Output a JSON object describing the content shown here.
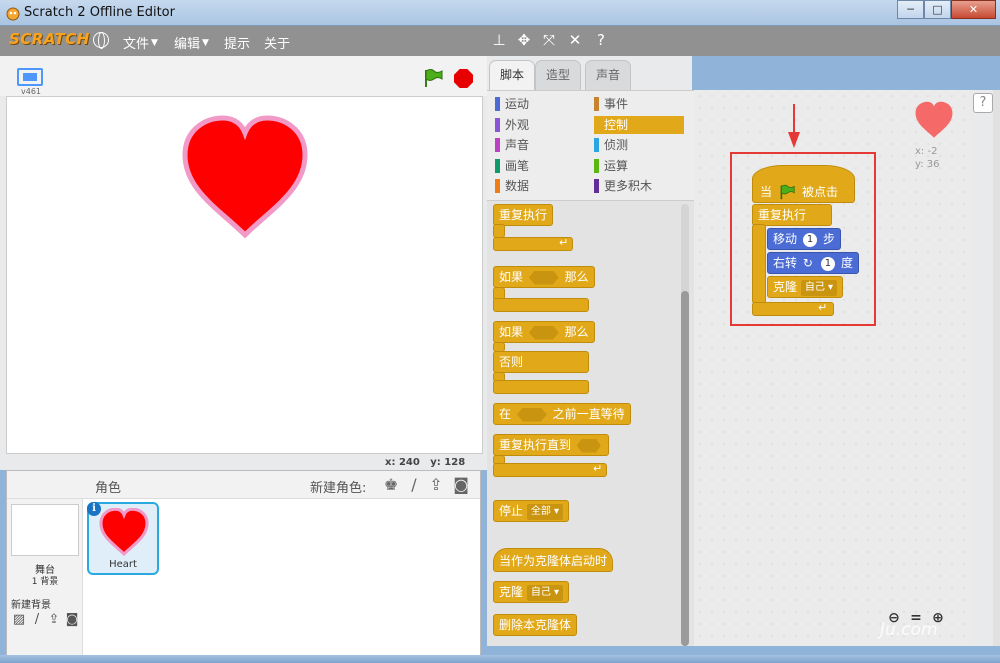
{
  "window": {
    "title": "Scratch 2 Offline Editor",
    "minimize": "─",
    "maximize": "□",
    "close": "✕"
  },
  "menubar": {
    "logo": "SCRATCH",
    "file": "文件",
    "edit": "编辑",
    "tips": "提示",
    "about": "关于",
    "caret": "▼",
    "tools": [
      "stamp-icon",
      "scissors-icon",
      "grow-icon",
      "shrink-icon",
      "help-icon"
    ]
  },
  "stage": {
    "version": "v461",
    "coord_x_label": "x:",
    "coord_x": "240",
    "coord_y_label": "y:",
    "coord_y": "128",
    "heart_color": "#ff0000",
    "heart_outline": "#f29ac7"
  },
  "sprites": {
    "label": "角色",
    "new_sprite_label": "新建角色:",
    "stage_name": "舞台",
    "stage_count": "1 背景",
    "new_backdrop_label": "新建背景",
    "selected_sprite": "Heart",
    "info": "i"
  },
  "tabs": [
    "脚本",
    "造型",
    "声音"
  ],
  "categories": [
    {
      "label": "运动",
      "color": "#4a6cd4"
    },
    {
      "label": "外观",
      "color": "#8a55d7"
    },
    {
      "label": "声音",
      "color": "#bb42c3"
    },
    {
      "label": "画笔",
      "color": "#0e9a6c"
    },
    {
      "label": "数据",
      "color": "#ee7d16"
    },
    {
      "label": "事件",
      "color": "#c88330"
    },
    {
      "label": "控制",
      "color": "#e1a91a"
    },
    {
      "label": "侦测",
      "color": "#2ca5e2"
    },
    {
      "label": "运算",
      "color": "#5cb712"
    },
    {
      "label": "更多积木",
      "color": "#632d99"
    }
  ],
  "palette_blocks": {
    "forever": "重复执行",
    "if": "如果",
    "then": "那么",
    "else": "否则",
    "wait_until_pre": "在",
    "wait_until_post": "之前一直等待",
    "repeat_until": "重复执行直到",
    "stop": "停止",
    "stop_option": "全部",
    "when_clone": "当作为克隆体启动时",
    "clone": "克隆",
    "clone_option": "自己",
    "delete_clone": "删除本克隆体"
  },
  "script": {
    "hat_pre": "当",
    "hat_post": "被点击",
    "forever": "重复执行",
    "move_pre": "移动",
    "move_value": "1",
    "move_post": "步",
    "turn_pre": "右转",
    "turn_value": "1",
    "turn_post": "度",
    "clone": "克隆",
    "clone_option": "自己",
    "sprite_x": "x: -2",
    "sprite_y": "y: 36"
  },
  "watermark": "Ju.com"
}
